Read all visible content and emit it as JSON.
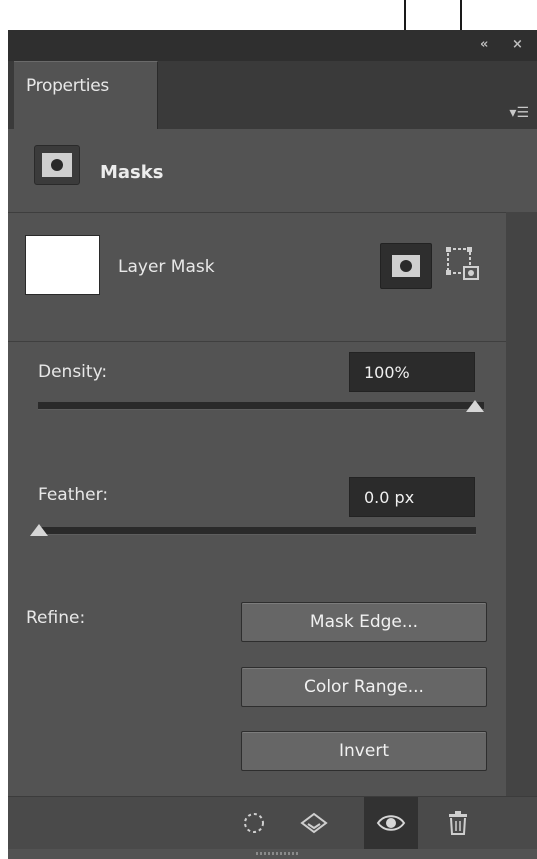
{
  "window": {
    "collapse_glyph": "«",
    "close_glyph": "×",
    "panel_menu_glyph": "▾☰"
  },
  "tab": {
    "label": "Properties"
  },
  "section": {
    "icon": "mask-thumbnail-icon",
    "label": "Masks"
  },
  "layer_mask": {
    "label": "Layer Mask",
    "pixel_mask_icon": "pixel-mask-icon",
    "vector_mask_icon": "vector-mask-icon"
  },
  "density": {
    "label": "Density:",
    "value": "100%",
    "slider_fraction": 1.0
  },
  "feather": {
    "label": "Feather:",
    "value": "0.0 px",
    "slider_fraction": 0.0
  },
  "refine": {
    "label": "Refine:",
    "buttons": [
      "Mask Edge...",
      "Color Range...",
      "Invert"
    ]
  },
  "bottom_bar": {
    "icons": [
      "load-selection-icon",
      "apply-mask-icon",
      "toggle-visibility-icon",
      "delete-mask-icon"
    ],
    "active_icon": "toggle-visibility-icon"
  },
  "colors": {
    "panel_bg": "#535353",
    "title_bar": "#2f2f2f",
    "field_bg": "#2b2b2b",
    "button_bg": "#666666"
  }
}
